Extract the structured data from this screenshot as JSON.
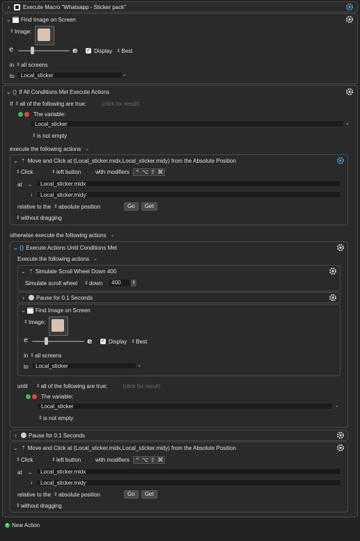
{
  "macro": {
    "title": "Execute Macro \"Whatsapp - Sticker pack\""
  },
  "find1": {
    "title": "Find Image on Screen",
    "image_label": "Image:",
    "display_label": "Display",
    "best_label": "Best",
    "in_label": "in",
    "screens_value": "all screens",
    "to_label": "to",
    "variable_value": "Local_sticker"
  },
  "ifall": {
    "title": "If All Conditions Met Execute Actions",
    "if_label": "If",
    "condition_mode": "all of the following are true:",
    "click_hint": "(click for result)",
    "variable_label": "The variable:",
    "variable_value": "Local_sticker",
    "condition_test": "is not empty",
    "then_label": "execute the following actions",
    "otherwise_label": "otherwise execute the following actions"
  },
  "move1": {
    "title": "Move and Click at (Local_sticker.midx,Local_sticker.midy) from the Absolute Position",
    "click_value": "Click",
    "button_value": "left button",
    "modifiers_label": "with modifiers",
    "modifier_keys": [
      "^",
      "⌥",
      "⇧",
      "⌘"
    ],
    "at_label": "at",
    "x_value": "Local_sticker.midx",
    "y_value": "Local_sticker.midy",
    "relative_label": "relative to the",
    "position_value": "absolute position",
    "go_label": "Go",
    "get_label": "Get",
    "drag_value": "without dragging"
  },
  "until": {
    "title": "Execute Actions Until Conditions Met",
    "execute_label": "Execute the following actions",
    "until_label": "until",
    "condition_mode": "all of the following are true:",
    "click_hint": "(click for result)",
    "variable_label": "The variable:",
    "variable_value": "Local_sticker",
    "condition_test": "is not empty"
  },
  "scroll": {
    "title": "Simulate Scroll Wheel Down 400",
    "label": "Simulate scroll wheel",
    "direction": "down",
    "amount": "400"
  },
  "pause1": {
    "title": "Pause for 0.1 Seconds"
  },
  "find2": {
    "title": "Find Image on Screen",
    "image_label": "Image:",
    "display_label": "Display",
    "best_label": "Best",
    "in_label": "in",
    "screens_value": "all screens",
    "to_label": "to",
    "variable_value": "Local_sticker"
  },
  "pause2": {
    "title": "Pause for 0.1 Seconds"
  },
  "move2": {
    "title": "Move and Click at (Local_sticker.midx,Local_sticker.midy) from the Absolute Position",
    "click_value": "Click",
    "button_value": "left button",
    "modifiers_label": "with modifiers",
    "modifier_keys": [
      "^",
      "⌥",
      "⇧",
      "⌘"
    ],
    "at_label": "at",
    "x_value": "Local_sticker.midx",
    "y_value": "Local_sticker.midy",
    "relative_label": "relative to the",
    "position_value": "absolute position",
    "go_label": "Go",
    "get_label": "Get",
    "drag_value": "without dragging"
  },
  "footer": {
    "new_action_label": "New Action"
  },
  "colors": {
    "accent_blue": "#4a9dd8",
    "green": "#3fb950",
    "red": "#e0453d",
    "panel": "#2a2a2a",
    "background": "#232323"
  }
}
